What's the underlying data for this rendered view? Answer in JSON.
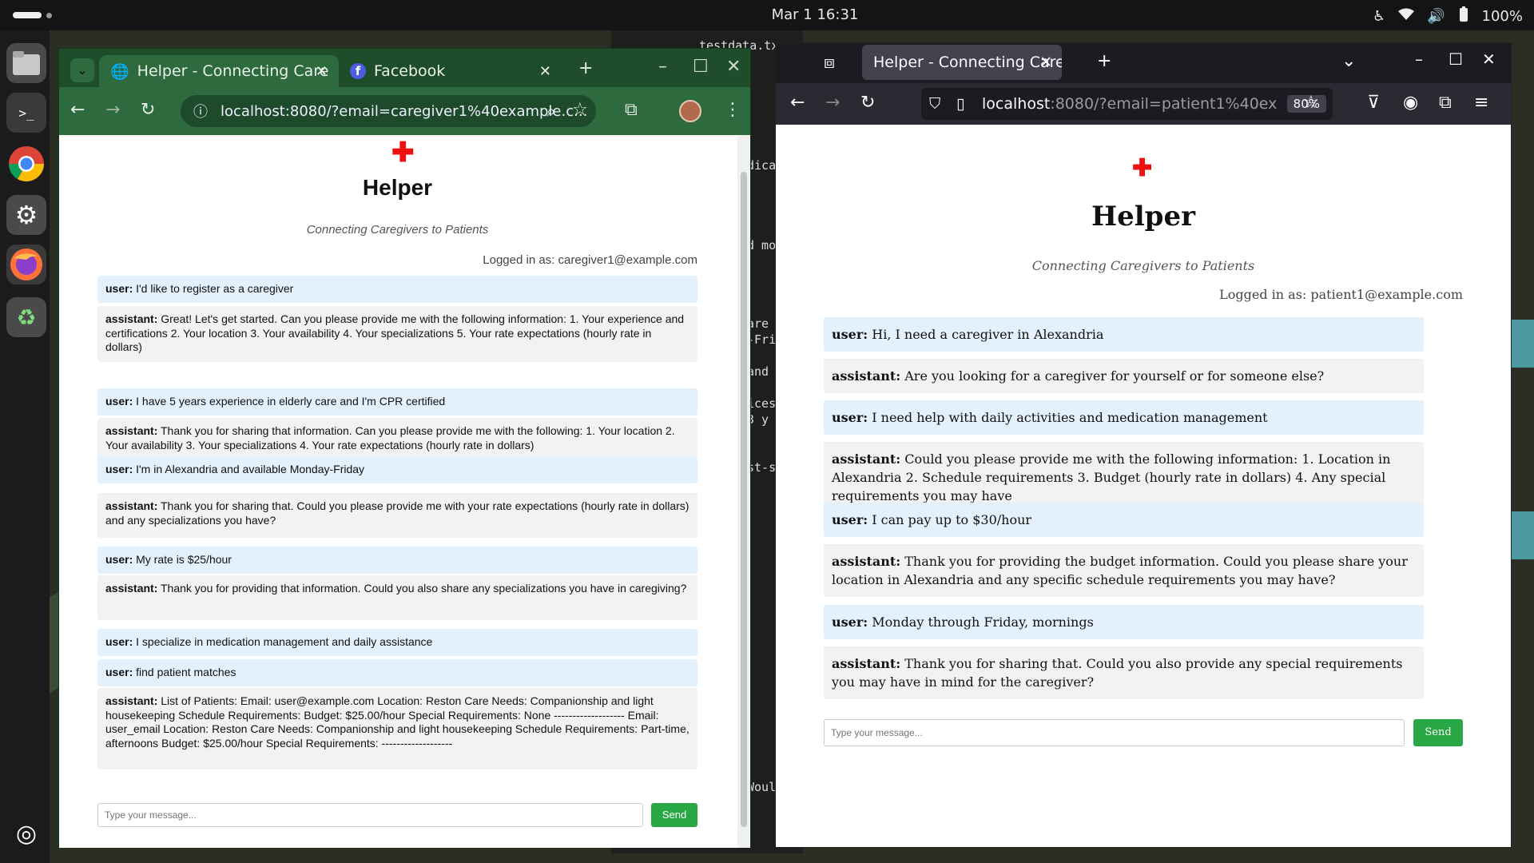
{
  "system": {
    "clock": "Mar 1  16:31",
    "battery": "100%"
  },
  "terminal_fragments": [
    "testdata.tx",
    "dica",
    "d mo",
    "are",
    "-Fri",
    "and",
    "ices",
    "3 y",
    "st-s",
    "Woul"
  ],
  "chrome": {
    "tabs": [
      {
        "title": "Helper - Connecting Care",
        "close": "✕"
      },
      {
        "title": "Facebook",
        "close": "✕"
      }
    ],
    "url": "localhost:8080/?email=caregiver1%40example.c..."
  },
  "firefox": {
    "tab_title": "Helper - Connecting Caregive",
    "url_host": "localhost",
    "url_rest": ":8080/?email=patient1%40ex",
    "zoom": "80%"
  },
  "left_app": {
    "title": "Helper",
    "subtitle": "Connecting Caregivers to Patients",
    "logged_in": "Logged in as: caregiver1@example.com",
    "messages": [
      {
        "role": "user:",
        "text": " I'd like to register as a caregiver"
      },
      {
        "role": "assistant:",
        "text": " Great! Let's get started. Can you please provide me with the following information: 1. Your experience and certifications 2. Your location 3. Your availability 4. Your specializations 5. Your rate expectations (hourly rate in dollars)"
      },
      {
        "role": "user:",
        "text": " I have 5 years experience in elderly care and I'm CPR certified"
      },
      {
        "role": "assistant:",
        "text": " Thank you for sharing that information. Can you please provide me with the following: 1. Your location 2. Your availability 3. Your specializations 4. Your rate expectations (hourly rate in dollars)"
      },
      {
        "role": "user:",
        "text": " I'm in Alexandria and available Monday-Friday"
      },
      {
        "role": "assistant:",
        "text": " Thank you for sharing that. Could you please provide me with your rate expectations (hourly rate in dollars) and any specializations you have?"
      },
      {
        "role": "user:",
        "text": " My rate is $25/hour"
      },
      {
        "role": "assistant:",
        "text": " Thank you for providing that information. Could you also share any specializations you have in caregiving?"
      },
      {
        "role": "user:",
        "text": " I specialize in medication management and daily assistance"
      },
      {
        "role": "user:",
        "text": " find patient matches"
      },
      {
        "role": "assistant:",
        "text": " List of Patients: Email: user@example.com Location: Reston Care Needs: Companionship and light housekeeping Schedule Requirements: Budget: $25.00/hour Special Requirements: None ------------------- Email: user_email Location: Reston Care Needs: Companionship and light housekeeping Schedule Requirements: Part-time, afternoons Budget: $25.00/hour Special Requirements: -------------------"
      }
    ],
    "input_placeholder": "Type your message...",
    "send_label": "Send"
  },
  "right_app": {
    "title": "Helper",
    "subtitle": "Connecting Caregivers to Patients",
    "logged_in": "Logged in as: patient1@example.com",
    "messages": [
      {
        "role": "user:",
        "text": " Hi, I need a caregiver in Alexandria"
      },
      {
        "role": "assistant:",
        "text": " Are you looking for a caregiver for yourself or for someone else?"
      },
      {
        "role": "user:",
        "text": " I need help with daily activities and medication management"
      },
      {
        "role": "assistant:",
        "text": " Could you please provide me with the following information: 1. Location in Alexandria 2. Schedule requirements 3. Budget (hourly rate in dollars) 4. Any special requirements you may have"
      },
      {
        "role": "user:",
        "text": " I can pay up to $30/hour"
      },
      {
        "role": "assistant:",
        "text": " Thank you for providing the budget information. Could you please share your location in Alexandria and any specific schedule requirements you may have?"
      },
      {
        "role": "user:",
        "text": " Monday through Friday, mornings"
      },
      {
        "role": "assistant:",
        "text": " Thank you for sharing that. Could you also provide any special requirements you may have in mind for the caregiver?"
      }
    ],
    "input_placeholder": "Type your message...",
    "send_label": "Send"
  },
  "colors": {
    "user_bubble": "#e3f1fc",
    "assistant_bubble": "#f2f2f2",
    "send_button": "#28a745",
    "chrome_theme": "#2d6a3e",
    "cross": "#e11"
  }
}
